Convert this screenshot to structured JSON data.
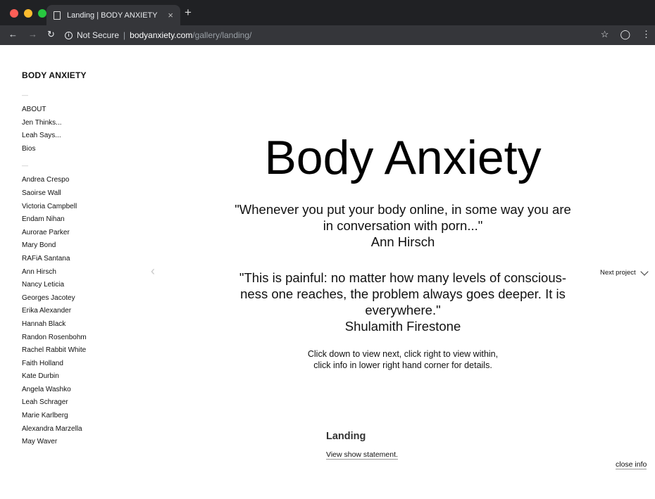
{
  "browser": {
    "tab_title": "Landing | BODY ANXIETY",
    "tab_close": "×",
    "new_tab": "+",
    "security_label": "Not Secure",
    "url_host": "bodyanxiety.com",
    "url_path": "/gallery/landing/",
    "icons": [
      "back-icon",
      "forward-icon",
      "reload-icon",
      "info-icon",
      "star-icon",
      "extension-icon",
      "menu-icon"
    ],
    "colors": {
      "close": "#ff5f57",
      "minimize": "#febc2e",
      "maximize": "#28c840"
    }
  },
  "sidebar": {
    "site_title": "BODY ANXIETY",
    "separator": "—",
    "menu": [
      "ABOUT",
      "Jen Thinks...",
      "Leah Says...",
      "Bios"
    ],
    "artists": [
      "Andrea Crespo",
      "Saoirse Wall",
      "Victoria Campbell",
      "Endam Nihan",
      "Aurorae Parker",
      "Mary Bond",
      "RAFiA Santana",
      "Ann Hirsch",
      "Nancy Leticia",
      "Georges Jacotey",
      "Erika Alexander",
      "Hannah Black",
      "Randon Rosenbohm",
      "Rachel Rabbit White",
      "Faith Holland",
      "Kate Durbin",
      "Angela Washko",
      "Leah Schrager",
      "Marie Karlberg",
      "Alexandra Marzella",
      "May Waver"
    ]
  },
  "main": {
    "title": "Body Anxiety",
    "quote1": {
      "line1": "\"Whenever you put your body online, in some way you are",
      "line2": "in conversation with porn...\"",
      "author": "Ann Hirsch"
    },
    "quote2": {
      "line1": "\"This is painful: no matter how many levels of conscious-",
      "line2": "ness one reaches, the problem always goes deeper. It is",
      "line3": "everywhere.\"",
      "author": "Shulamith Firestone"
    },
    "hint": {
      "line1": "Click down to view next, click right to view within,",
      "line2": "click info in lower right hand corner for details."
    }
  },
  "navigation": {
    "prev": "‹",
    "next_label": "Next project"
  },
  "info": {
    "title": "Landing",
    "link": "View show statement.",
    "close": "close info"
  }
}
